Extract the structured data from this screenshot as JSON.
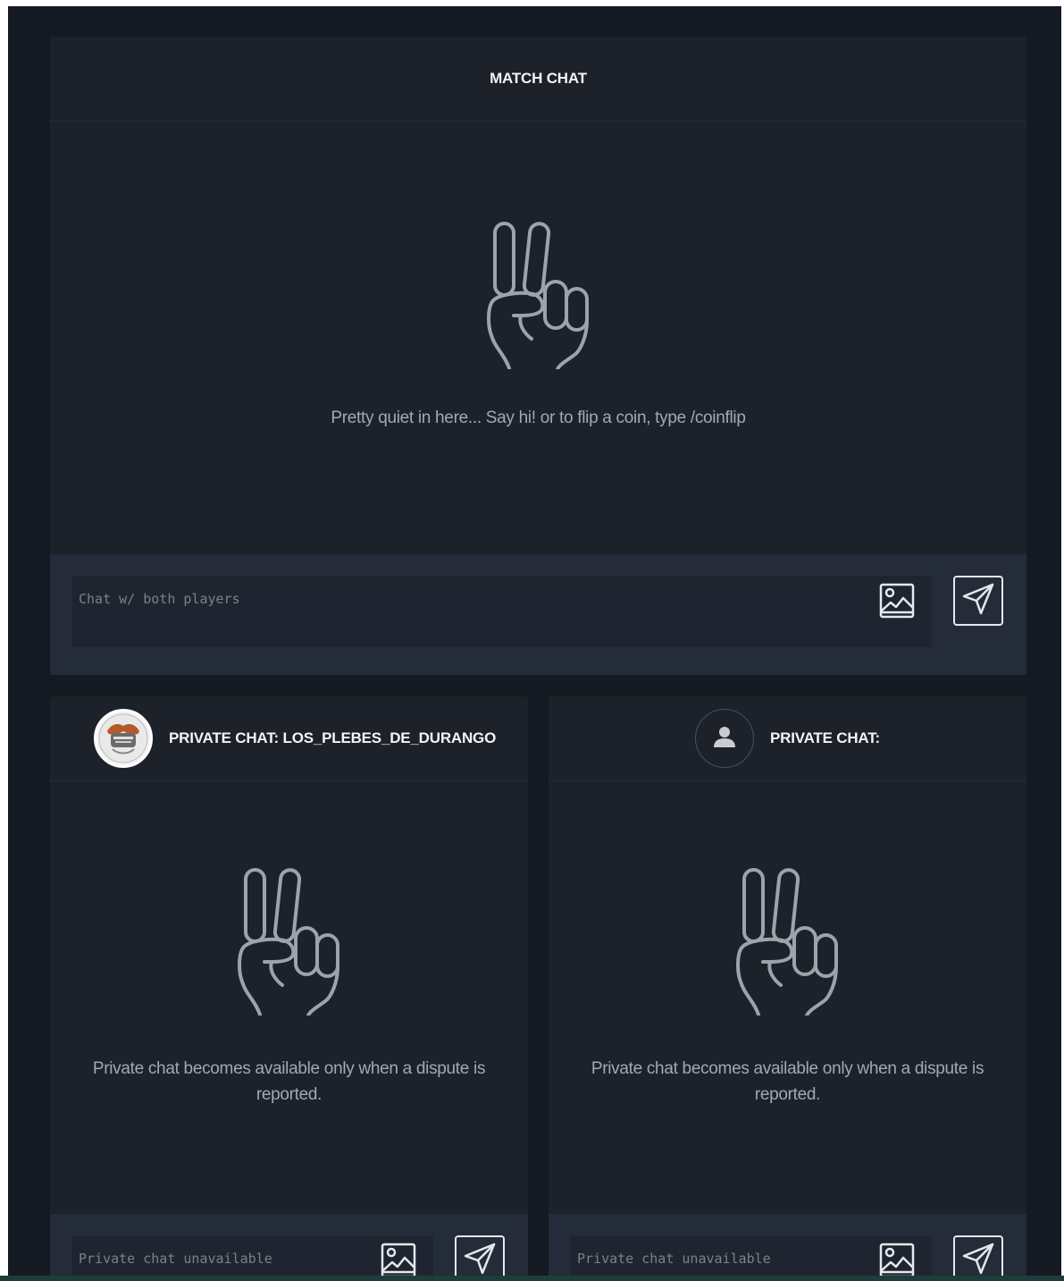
{
  "match_chat": {
    "title": "MATCH CHAT",
    "empty_icon": "peace-hand-icon",
    "empty_text": "Pretty quiet in here... Say hi! or to flip a coin, type /coinflip",
    "input_placeholder": "Chat w/ both players",
    "image_icon": "image-icon",
    "send_icon": "send-icon"
  },
  "private_chats": [
    {
      "title": "PRIVATE CHAT: LOS_PLEBES_DE_DURANGO",
      "avatar": "team-logo-avatar",
      "empty_text": "Private chat becomes available only when a dispute is reported.",
      "input_placeholder": "Private chat unavailable"
    },
    {
      "title": "PRIVATE CHAT:",
      "avatar": "user-icon",
      "empty_text": "Private chat becomes available only when a dispute is reported.",
      "input_placeholder": "Private chat unavailable"
    }
  ],
  "colors": {
    "background": "#151a22",
    "panel": "#1c212a",
    "input_bar": "#252c39",
    "icon_stroke": "#9ea3ab",
    "title_text": "#f2f4f7"
  }
}
